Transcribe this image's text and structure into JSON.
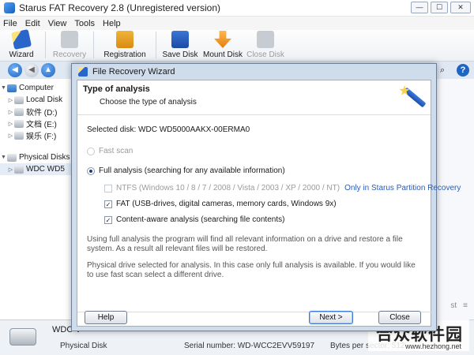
{
  "window": {
    "title": "Starus FAT Recovery 2.8 (Unregistered version)",
    "min": "—",
    "max": "☐",
    "close": "✕"
  },
  "menu": [
    "File",
    "Edit",
    "View",
    "Tools",
    "Help"
  ],
  "toolbar": {
    "wizard": "Wizard",
    "recovery": "Recovery",
    "registration": "Registration",
    "save_disk": "Save Disk",
    "mount_disk": "Mount Disk",
    "close_disk": "Close Disk"
  },
  "nav": {
    "back": "◀",
    "forward": "◀",
    "up": "▲",
    "search_icon": "⌕",
    "help_icon": "?"
  },
  "tree": {
    "computer": "Computer",
    "local_disk": "Local Disk",
    "d": "软件 (D:)",
    "e": "文档 (E:)",
    "f": "娱乐 (F:)",
    "physical": "Physical Disks",
    "wdc": "WDC WD5"
  },
  "rightarea": {
    "list_label": "st",
    "view_icon": "≡"
  },
  "status": {
    "name": "WDC V",
    "type": "Physical Disk",
    "serial": "Serial number: WD-WCC2EVV59197",
    "bytes": "Bytes per sector: 512"
  },
  "watermark": {
    "text": "合众软件园",
    "url": "www.hezhong.net"
  },
  "dialog": {
    "title": "File Recovery Wizard",
    "heading": "Type of analysis",
    "subheading": "Choose the type of analysis",
    "selected_disk": "Selected disk: WDC WD5000AAKX-00ERMA0",
    "fast_scan": "Fast scan",
    "full_analysis": "Full analysis (searching for any available information)",
    "ntfs": "NTFS (Windows 10 / 8 / 7 / 2008 / Vista / 2003 / XP / 2000 / NT)",
    "ntfs_link": "Only in Starus Partition Recovery",
    "fat": "FAT (USB-drives, digital cameras, memory cards, Windows 9x)",
    "content_aware": "Content-aware analysis (searching file contents)",
    "check": "✓",
    "info1": "Using full analysis the program will find all relevant information on a drive and restore a file system. As a result all relevant files will be restored.",
    "info2": "Physical drive selected for analysis. In this case only full analysis is available. If you would like to use fast scan select a different drive.",
    "help_btn": "Help",
    "next_btn": "Next >",
    "close_btn": "Close"
  }
}
